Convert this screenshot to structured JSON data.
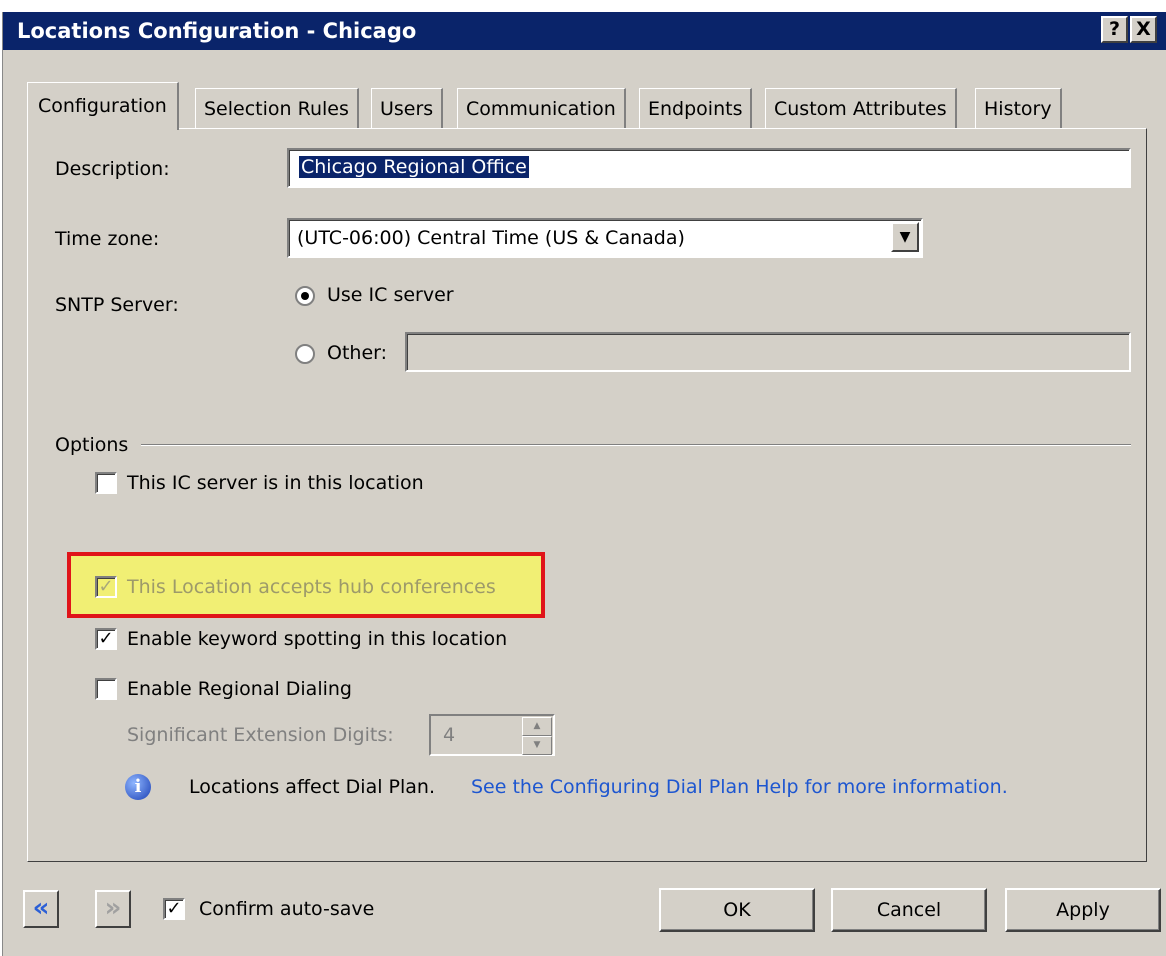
{
  "window": {
    "title": "Locations Configuration - Chicago",
    "help_glyph": "?",
    "close_glyph": "X"
  },
  "tabs": [
    {
      "label": "Configuration"
    },
    {
      "label": "Selection Rules"
    },
    {
      "label": "Users"
    },
    {
      "label": "Communication"
    },
    {
      "label": "Endpoints"
    },
    {
      "label": "Custom Attributes"
    },
    {
      "label": "History"
    }
  ],
  "form": {
    "description_label": "Description:",
    "description_value": "Chicago Regional Office",
    "timezone_label": "Time zone:",
    "timezone_value": "(UTC-06:00) Central Time (US & Canada)",
    "sntp_label": "SNTP Server:",
    "sntp_use_ic": "Use IC server",
    "sntp_use_ic_selected": true,
    "sntp_other": "Other:",
    "sntp_other_value": ""
  },
  "options": {
    "group_label": "Options",
    "ic_server_here": {
      "label": "This IC server is in this location",
      "checked": false
    },
    "accepts_hub": {
      "label": "This Location accepts hub conferences",
      "checked": true,
      "enabled": false
    },
    "keyword_spotting": {
      "label": "Enable keyword spotting in this location",
      "checked": true
    },
    "regional_dialing": {
      "label": "Enable Regional Dialing",
      "checked": false
    },
    "sig_ext_label": "Significant Extension Digits:",
    "sig_ext_value": "4"
  },
  "info": {
    "text": "Locations affect Dial Plan.",
    "link": "See the Configuring Dial Plan Help for more information."
  },
  "footer": {
    "confirm_autosave": {
      "label": "Confirm auto-save",
      "checked": true
    },
    "ok": "OK",
    "cancel": "Cancel",
    "apply": "Apply"
  },
  "colors": {
    "title_bar": "#0a246a",
    "highlight_fill": "#f1ef74",
    "highlight_border": "#e0141a",
    "link": "#1d56d0"
  }
}
